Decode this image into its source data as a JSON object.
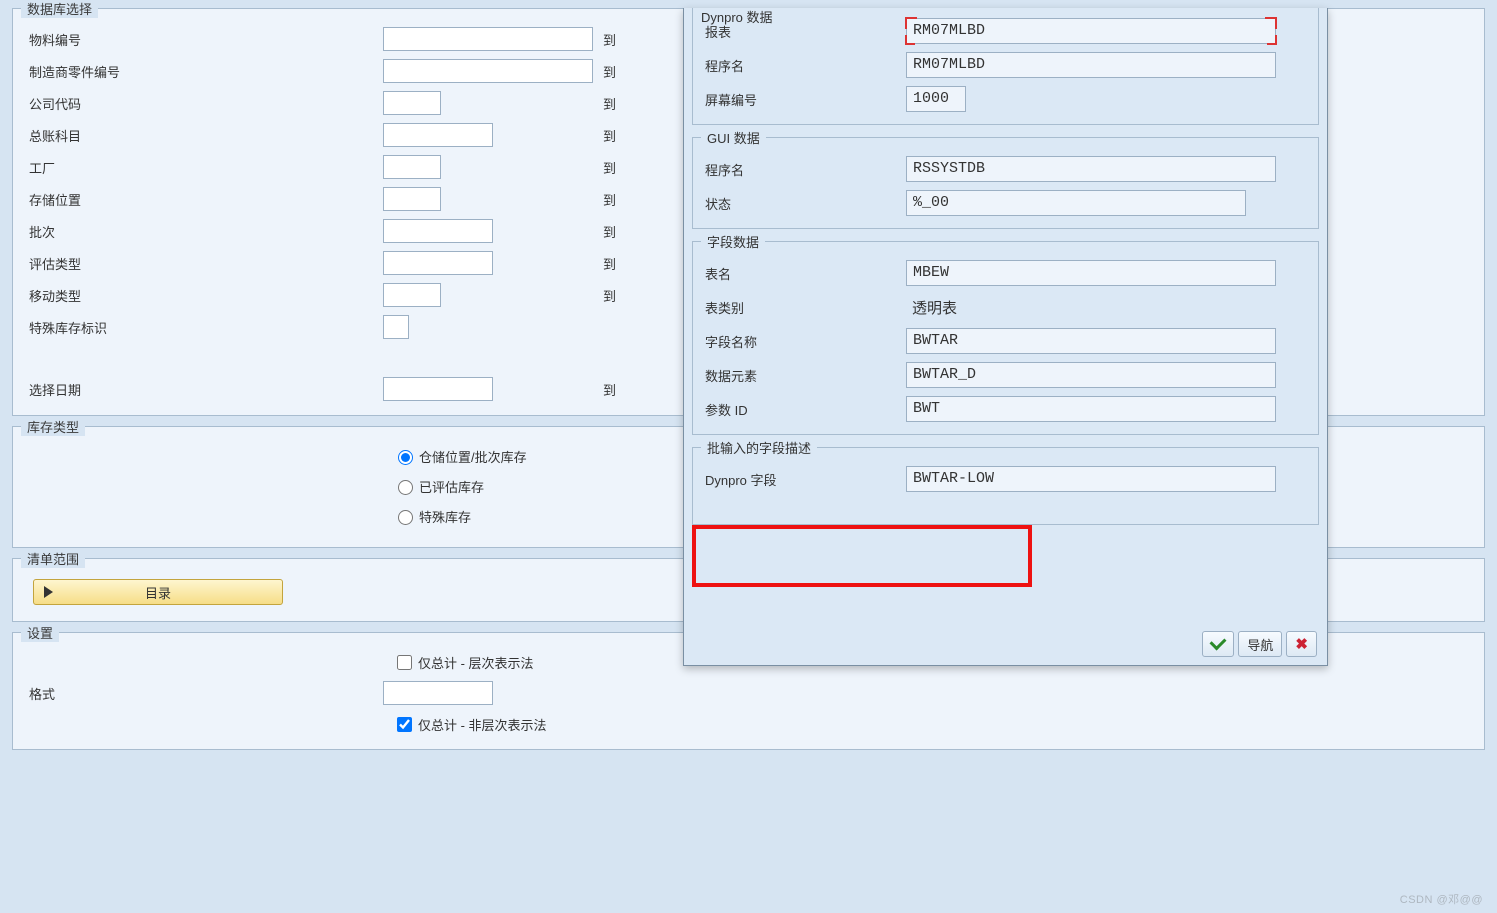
{
  "db_select": {
    "title": "数据库选择",
    "rows": {
      "material": "物料编号",
      "mfr_part": "制造商零件编号",
      "company": "公司代码",
      "gl_account": "总账科目",
      "plant": "工厂",
      "storage": "存储位置",
      "batch": "批次",
      "valuation": "评估类型",
      "move_type": "移动类型",
      "special_stock": "特殊库存标识",
      "sel_date": "选择日期"
    },
    "to": "到"
  },
  "stock_type": {
    "title": "库存类型",
    "options": {
      "loc_batch": "仓储位置/批次库存",
      "valuated": "已评估库存",
      "special": "特殊库存"
    }
  },
  "list_range": {
    "title": "清单范围",
    "directory_btn": "目录"
  },
  "settings": {
    "title": "设置",
    "totals_hier": "仅总计 - 层次表示法",
    "format": "格式",
    "totals_nonhier": "仅总计 - 非层次表示法"
  },
  "popup": {
    "dynpro": {
      "title": "Dynpro 数据",
      "report_lbl": "报表",
      "report_val": "RM07MLBD",
      "program_lbl": "程序名",
      "program_val": "RM07MLBD",
      "screen_lbl": "屏幕编号",
      "screen_val": "1000"
    },
    "gui": {
      "title": "GUI 数据",
      "program_lbl": "程序名",
      "program_val": "RSSYSTDB",
      "status_lbl": "状态",
      "status_val": "%_00"
    },
    "field": {
      "title": "字段数据",
      "table_lbl": "表名",
      "table_val": "MBEW",
      "cat_lbl": "表类别",
      "cat_val": "透明表",
      "field_lbl": "字段名称",
      "field_val": "BWTAR",
      "elem_lbl": "数据元素",
      "elem_val": "BWTAR_D",
      "param_lbl": "参数 ID",
      "param_val": "BWT"
    },
    "batch": {
      "title": "批输入的字段描述",
      "dynpro_field_lbl": "Dynpro 字段",
      "dynpro_field_val": "BWTAR-LOW"
    },
    "footer": {
      "nav": "导航"
    }
  },
  "watermark": "CSDN @邓@@"
}
